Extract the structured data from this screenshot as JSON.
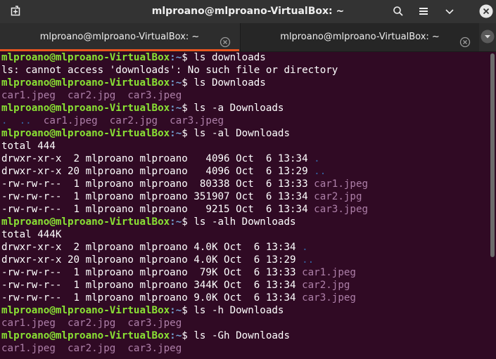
{
  "window": {
    "title": "mlproano@mlproano-VirtualBox: ~"
  },
  "tabs": [
    {
      "label": "mlproano@mlproano-VirtualBox: ~",
      "active": true
    },
    {
      "label": "mlproano@mlproano-VirtualBox: ~",
      "active": false
    }
  ],
  "icons": {
    "new_tab": "new-tab-icon",
    "search": "search-icon",
    "menu": "hamburger-menu-icon",
    "minimize": "chevron-down-icon",
    "close": "close-icon"
  },
  "colors": {
    "background": "#300a24",
    "prompt_user": "#8ae234",
    "prompt_path": "#729fcf",
    "image_file": "#ad7fa8",
    "directory": "#3465a4",
    "accent": "#e95420"
  },
  "terminal": {
    "lines": [
      {
        "kind": "prompt",
        "user": "mlproano@mlproano-VirtualBox",
        "path": ":~",
        "cmd": "$ ls downloads"
      },
      {
        "kind": "text",
        "text": "ls: cannot access 'downloads': No such file or directory"
      },
      {
        "kind": "prompt",
        "user": "mlproano@mlproano-VirtualBox",
        "path": ":~",
        "cmd": "$ ls Downloads"
      },
      {
        "kind": "files",
        "text": "car1.jpeg  car2.jpg  car3.jpeg"
      },
      {
        "kind": "prompt",
        "user": "mlproano@mlproano-VirtualBox",
        "path": ":~",
        "cmd": "$ ls -a Downloads"
      },
      {
        "kind": "dirfiles",
        "dirs": ".  ..  ",
        "files": "car1.jpeg  car2.jpg  car3.jpeg"
      },
      {
        "kind": "prompt",
        "user": "mlproano@mlproano-VirtualBox",
        "path": ":~",
        "cmd": "$ ls -al Downloads"
      },
      {
        "kind": "text",
        "text": "total 444"
      },
      {
        "kind": "entry",
        "info": "drwxr-xr-x  2 mlproano mlproano   4096 Oct  6 13:34 ",
        "name": ".",
        "type": "dir"
      },
      {
        "kind": "entry",
        "info": "drwxr-xr-x 20 mlproano mlproano   4096 Oct  6 13:29 ",
        "name": "..",
        "type": "dir"
      },
      {
        "kind": "entry",
        "info": "-rw-rw-r--  1 mlproano mlproano  80338 Oct  6 13:33 ",
        "name": "car1.jpeg",
        "type": "img"
      },
      {
        "kind": "entry",
        "info": "-rw-rw-r--  1 mlproano mlproano 351907 Oct  6 13:34 ",
        "name": "car2.jpg",
        "type": "img"
      },
      {
        "kind": "entry",
        "info": "-rw-rw-r--  1 mlproano mlproano   9215 Oct  6 13:34 ",
        "name": "car3.jpeg",
        "type": "img"
      },
      {
        "kind": "prompt",
        "user": "mlproano@mlproano-VirtualBox",
        "path": ":~",
        "cmd": "$ ls -alh Downloads"
      },
      {
        "kind": "text",
        "text": "total 444K"
      },
      {
        "kind": "entry",
        "info": "drwxr-xr-x  2 mlproano mlproano 4.0K Oct  6 13:34 ",
        "name": ".",
        "type": "dir"
      },
      {
        "kind": "entry",
        "info": "drwxr-xr-x 20 mlproano mlproano 4.0K Oct  6 13:29 ",
        "name": "..",
        "type": "dir"
      },
      {
        "kind": "entry",
        "info": "-rw-rw-r--  1 mlproano mlproano  79K Oct  6 13:33 ",
        "name": "car1.jpeg",
        "type": "img"
      },
      {
        "kind": "entry",
        "info": "-rw-rw-r--  1 mlproano mlproano 344K Oct  6 13:34 ",
        "name": "car2.jpg",
        "type": "img"
      },
      {
        "kind": "entry",
        "info": "-rw-rw-r--  1 mlproano mlproano 9.0K Oct  6 13:34 ",
        "name": "car3.jpeg",
        "type": "img"
      },
      {
        "kind": "prompt",
        "user": "mlproano@mlproano-VirtualBox",
        "path": ":~",
        "cmd": "$ ls -h Downloads"
      },
      {
        "kind": "files",
        "text": "car1.jpeg  car2.jpg  car3.jpeg"
      },
      {
        "kind": "prompt",
        "user": "mlproano@mlproano-VirtualBox",
        "path": ":~",
        "cmd": "$ ls -Gh Downloads"
      },
      {
        "kind": "files",
        "text": "car1.jpeg  car2.jpg  car3.jpeg"
      }
    ]
  }
}
